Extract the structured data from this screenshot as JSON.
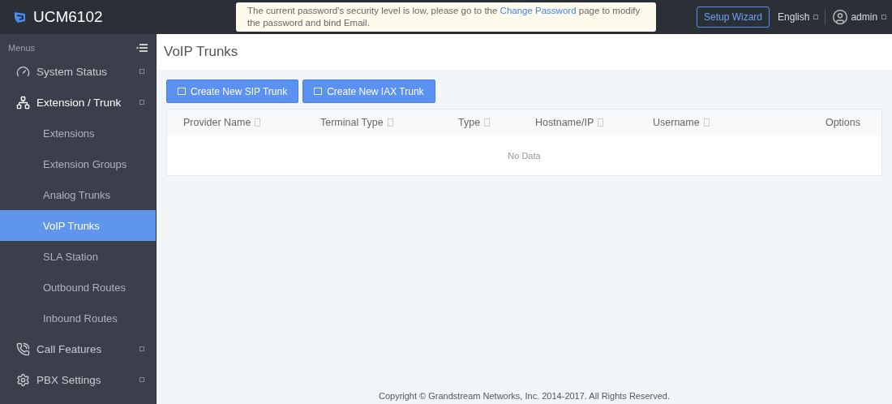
{
  "header": {
    "product": "UCM6102",
    "notice_parts": [
      "The current password's security level is low, please go to the",
      "Change Password",
      "page to modify the password and bind Email."
    ],
    "setup_wizard": "Setup Wizard",
    "language": "English",
    "user": "admin"
  },
  "sidebar": {
    "title": "Menus",
    "items": [
      {
        "label": "System Status",
        "expanded": false
      },
      {
        "label": "Extension / Trunk",
        "expanded": true,
        "children": [
          {
            "label": "Extensions",
            "selected": false
          },
          {
            "label": "Extension Groups",
            "selected": false
          },
          {
            "label": "Analog Trunks",
            "selected": false
          },
          {
            "label": "VoIP Trunks",
            "selected": true
          },
          {
            "label": "SLA Station",
            "selected": false
          },
          {
            "label": "Outbound Routes",
            "selected": false
          },
          {
            "label": "Inbound Routes",
            "selected": false
          }
        ]
      },
      {
        "label": "Call Features",
        "expanded": false
      },
      {
        "label": "PBX Settings",
        "expanded": false
      }
    ]
  },
  "page": {
    "title": "VoIP Trunks",
    "buttons": [
      "Create New SIP Trunk",
      "Create New IAX Trunk"
    ],
    "table": {
      "columns": [
        {
          "label": "Provider Name",
          "sortable": true
        },
        {
          "label": "Terminal Type",
          "sortable": true
        },
        {
          "label": "Type",
          "sortable": true
        },
        {
          "label": "Hostname/IP",
          "sortable": true
        },
        {
          "label": "Username",
          "sortable": true
        },
        {
          "label": "Options",
          "sortable": false
        }
      ],
      "empty": "No Data"
    }
  },
  "footer": "Copyright © Grandstream Networks, Inc. 2014-2017. All Rights Reserved."
}
